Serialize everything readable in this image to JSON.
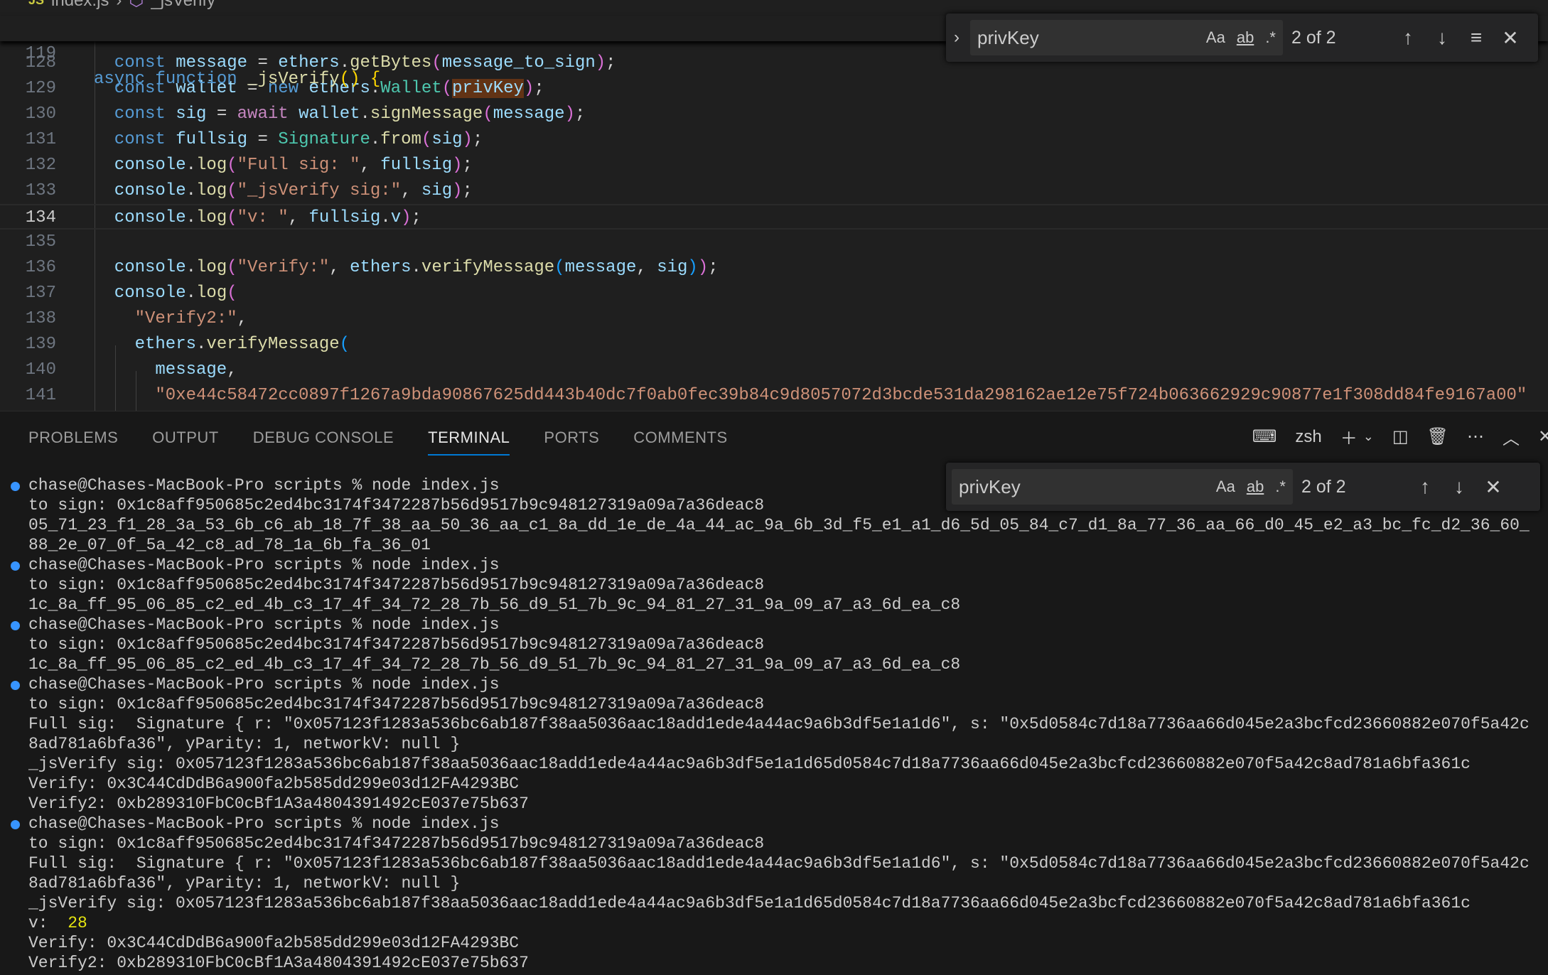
{
  "breadcrumb": {
    "file": "index.js",
    "symbol": "_jsVerify",
    "file_icon": "JS"
  },
  "sticky": {
    "num": "119",
    "tokens": [
      [
        "async ",
        "kw"
      ],
      [
        "function ",
        "kw"
      ],
      [
        "_jsVerify",
        "fn"
      ],
      [
        "(",
        "p1"
      ],
      [
        ")",
        "p1"
      ],
      [
        " ",
        "pl"
      ],
      [
        "{",
        "p1"
      ]
    ]
  },
  "editor": {
    "current_line": "134",
    "lines": [
      {
        "num": "128",
        "indent": 1,
        "tokens": [
          [
            "const ",
            "kw"
          ],
          [
            "message",
            "var"
          ],
          [
            " = ",
            "pl"
          ],
          [
            "ethers",
            "var"
          ],
          [
            ".",
            "pl"
          ],
          [
            "getBytes",
            "fn"
          ],
          [
            "(",
            "p2"
          ],
          [
            "message_to_sign",
            "var"
          ],
          [
            ")",
            "p2"
          ],
          [
            ";",
            "pl"
          ]
        ]
      },
      {
        "num": "129",
        "indent": 1,
        "tokens": [
          [
            "const ",
            "kw"
          ],
          [
            "wallet",
            "var"
          ],
          [
            " = ",
            "pl"
          ],
          [
            "new ",
            "kw"
          ],
          [
            "ethers",
            "var"
          ],
          [
            ".",
            "pl"
          ],
          [
            "Wallet",
            "cls"
          ],
          [
            "(",
            "p2"
          ],
          [
            "privKey",
            "var hl"
          ],
          [
            ")",
            "p2"
          ],
          [
            ";",
            "pl"
          ]
        ]
      },
      {
        "num": "130",
        "indent": 1,
        "tokens": [
          [
            "const ",
            "kw"
          ],
          [
            "sig",
            "var"
          ],
          [
            " = ",
            "pl"
          ],
          [
            "await ",
            "aw"
          ],
          [
            "wallet",
            "var"
          ],
          [
            ".",
            "pl"
          ],
          [
            "signMessage",
            "fn"
          ],
          [
            "(",
            "p2"
          ],
          [
            "message",
            "var"
          ],
          [
            ")",
            "p2"
          ],
          [
            ";",
            "pl"
          ]
        ]
      },
      {
        "num": "131",
        "indent": 1,
        "tokens": [
          [
            "const ",
            "kw"
          ],
          [
            "fullsig",
            "var"
          ],
          [
            " = ",
            "pl"
          ],
          [
            "Signature",
            "cls"
          ],
          [
            ".",
            "pl"
          ],
          [
            "from",
            "fn"
          ],
          [
            "(",
            "p2"
          ],
          [
            "sig",
            "var"
          ],
          [
            ")",
            "p2"
          ],
          [
            ";",
            "pl"
          ]
        ]
      },
      {
        "num": "132",
        "indent": 1,
        "tokens": [
          [
            "console",
            "var"
          ],
          [
            ".",
            "pl"
          ],
          [
            "log",
            "fn"
          ],
          [
            "(",
            "p2"
          ],
          [
            "\"Full sig: \"",
            "str"
          ],
          [
            ", ",
            "pl"
          ],
          [
            "fullsig",
            "var"
          ],
          [
            ")",
            "p2"
          ],
          [
            ";",
            "pl"
          ]
        ]
      },
      {
        "num": "133",
        "indent": 1,
        "tokens": [
          [
            "console",
            "var"
          ],
          [
            ".",
            "pl"
          ],
          [
            "log",
            "fn"
          ],
          [
            "(",
            "p2"
          ],
          [
            "\"_jsVerify sig:\"",
            "str"
          ],
          [
            ", ",
            "pl"
          ],
          [
            "sig",
            "var"
          ],
          [
            ")",
            "p2"
          ],
          [
            ";",
            "pl"
          ]
        ]
      },
      {
        "num": "134",
        "indent": 1,
        "tokens": [
          [
            "console",
            "var"
          ],
          [
            ".",
            "pl"
          ],
          [
            "log",
            "fn"
          ],
          [
            "(",
            "p2"
          ],
          [
            "\"v: \"",
            "str"
          ],
          [
            ", ",
            "pl"
          ],
          [
            "fullsig",
            "var"
          ],
          [
            ".",
            "pl"
          ],
          [
            "v",
            "var"
          ],
          [
            ")",
            "p2"
          ],
          [
            ";",
            "pl"
          ]
        ]
      },
      {
        "num": "135",
        "indent": 1,
        "tokens": []
      },
      {
        "num": "136",
        "indent": 1,
        "tokens": [
          [
            "console",
            "var"
          ],
          [
            ".",
            "pl"
          ],
          [
            "log",
            "fn"
          ],
          [
            "(",
            "p2"
          ],
          [
            "\"Verify:\"",
            "str"
          ],
          [
            ", ",
            "pl"
          ],
          [
            "ethers",
            "var"
          ],
          [
            ".",
            "pl"
          ],
          [
            "verifyMessage",
            "fn"
          ],
          [
            "(",
            "p3"
          ],
          [
            "message",
            "var"
          ],
          [
            ", ",
            "pl"
          ],
          [
            "sig",
            "var"
          ],
          [
            ")",
            "p3"
          ],
          [
            ")",
            "p2"
          ],
          [
            ";",
            "pl"
          ]
        ]
      },
      {
        "num": "137",
        "indent": 1,
        "tokens": [
          [
            "console",
            "var"
          ],
          [
            ".",
            "pl"
          ],
          [
            "log",
            "fn"
          ],
          [
            "(",
            "p2"
          ]
        ]
      },
      {
        "num": "138",
        "indent": 2,
        "tokens": [
          [
            "\"Verify2:\"",
            "str"
          ],
          [
            ",",
            "pl"
          ]
        ]
      },
      {
        "num": "139",
        "indent": 2,
        "tokens": [
          [
            "ethers",
            "var"
          ],
          [
            ".",
            "pl"
          ],
          [
            "verifyMessage",
            "fn"
          ],
          [
            "(",
            "p3"
          ]
        ]
      },
      {
        "num": "140",
        "indent": 3,
        "tokens": [
          [
            "message",
            "var"
          ],
          [
            ",",
            "pl"
          ]
        ]
      },
      {
        "num": "141",
        "indent": 3,
        "tokens": [
          [
            "\"0xe44c58472cc0897f1267a9bda90867625dd443b40dc7f0ab0fec39b84c9d8057072d3bcde531da298162ae12e75f724b063662929c90877e1f308dd84fe9167a00\"",
            "str"
          ]
        ]
      }
    ]
  },
  "editor_find": {
    "query": "privKey",
    "match_case": "Aa",
    "whole_word": "ab",
    "regex": ".*",
    "count": "2 of 2"
  },
  "panel": {
    "tabs": [
      "PROBLEMS",
      "OUTPUT",
      "DEBUG CONSOLE",
      "TERMINAL",
      "PORTS",
      "COMMENTS"
    ],
    "active_tab": "TERMINAL",
    "shell": "zsh"
  },
  "terminal_find": {
    "query": "privKey",
    "match_case": "Aa",
    "whole_word": "ab",
    "regex": ".*",
    "count": "2 of 2"
  },
  "terminal": [
    {
      "dot": true,
      "text": "chase@Chases-MacBook-Pro scripts % node index.js"
    },
    {
      "text": "to sign: 0x1c8aff950685c2ed4bc3174f3472287b56d9517b9c948127319a09a7a36deac8"
    },
    {
      "text": "05_71_23_f1_28_3a_53_6b_c6_ab_18_7f_38_aa_50_36_aa_c1_8a_dd_1e_de_4a_44_ac_9a_6b_3d_f5_e1_a1_d6_5d_05_84_c7_d1_8a_77_36_aa_66_d0_45_e2_a3_bc_fc_d2_36_60_"
    },
    {
      "text": "88_2e_07_0f_5a_42_c8_ad_78_1a_6b_fa_36_01"
    },
    {
      "dot": true,
      "text": "chase@Chases-MacBook-Pro scripts % node index.js"
    },
    {
      "text": "to sign: 0x1c8aff950685c2ed4bc3174f3472287b56d9517b9c948127319a09a7a36deac8"
    },
    {
      "text": "1c_8a_ff_95_06_85_c2_ed_4b_c3_17_4f_34_72_28_7b_56_d9_51_7b_9c_94_81_27_31_9a_09_a7_a3_6d_ea_c8"
    },
    {
      "dot": true,
      "text": "chase@Chases-MacBook-Pro scripts % node index.js"
    },
    {
      "text": "to sign: 0x1c8aff950685c2ed4bc3174f3472287b56d9517b9c948127319a09a7a36deac8"
    },
    {
      "text": "1c_8a_ff_95_06_85_c2_ed_4b_c3_17_4f_34_72_28_7b_56_d9_51_7b_9c_94_81_27_31_9a_09_a7_a3_6d_ea_c8"
    },
    {
      "dot": true,
      "text": "chase@Chases-MacBook-Pro scripts % node index.js"
    },
    {
      "text": "to sign: 0x1c8aff950685c2ed4bc3174f3472287b56d9517b9c948127319a09a7a36deac8"
    },
    {
      "text": "Full sig:  Signature { r: \"0x057123f1283a536bc6ab187f38aa5036aac18add1ede4a44ac9a6b3df5e1a1d6\", s: \"0x5d0584c7d18a7736aa66d045e2a3bcfcd23660882e070f5a42c"
    },
    {
      "text": "8ad781a6bfa36\", yParity: 1, networkV: null }"
    },
    {
      "text": "_jsVerify sig: 0x057123f1283a536bc6ab187f38aa5036aac18add1ede4a44ac9a6b3df5e1a1d65d0584c7d18a7736aa66d045e2a3bcfcd23660882e070f5a42c8ad781a6bfa361c"
    },
    {
      "text": "Verify: 0x3C44CdDdB6a900fa2b585dd299e03d12FA4293BC"
    },
    {
      "text": "Verify2: 0xb289310FbC0cBf1A3a4804391492cE037e75b637"
    },
    {
      "dot": true,
      "text": "chase@Chases-MacBook-Pro scripts % node index.js"
    },
    {
      "text": "to sign: 0x1c8aff950685c2ed4bc3174f3472287b56d9517b9c948127319a09a7a36deac8"
    },
    {
      "text": "Full sig:  Signature { r: \"0x057123f1283a536bc6ab187f38aa5036aac18add1ede4a44ac9a6b3df5e1a1d6\", s: \"0x5d0584c7d18a7736aa66d045e2a3bcfcd23660882e070f5a42c"
    },
    {
      "text": "8ad781a6bfa36\", yParity: 1, networkV: null }"
    },
    {
      "text": "_jsVerify sig: 0x057123f1283a536bc6ab187f38aa5036aac18add1ede4a44ac9a6b3df5e1a1d65d0584c7d18a7736aa66d045e2a3bcfcd23660882e070f5a42c8ad781a6bfa361c"
    },
    {
      "text": "v:  ",
      "value": "28"
    },
    {
      "text": "Verify: 0x3C44CdDdB6a900fa2b585dd299e03d12FA4293BC"
    },
    {
      "text": "Verify2: 0xb289310FbC0cBf1A3a4804391492cE037e75b637"
    }
  ],
  "colors": {
    "editor_bg": "#1f1f1f",
    "terminal_bg": "#181818",
    "accent": "#0078d4",
    "prompt_dot": "#3794ff",
    "find_highlight": "#623315"
  }
}
